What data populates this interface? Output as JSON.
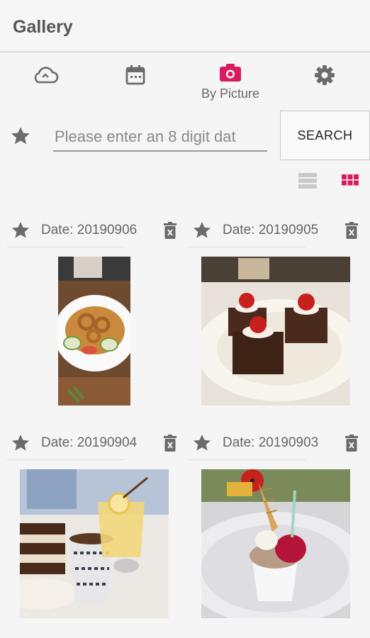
{
  "app": {
    "title": "Gallery"
  },
  "tabs": [
    {
      "icon": "cloud-icon",
      "label": ""
    },
    {
      "icon": "calendar-icon",
      "label": ""
    },
    {
      "icon": "camera-icon",
      "label": "By Picture",
      "active": true
    },
    {
      "icon": "gear-icon",
      "label": ""
    }
  ],
  "search": {
    "placeholder": "Please enter an 8 digit dat",
    "value": "",
    "button_label": "SEARCH"
  },
  "view": {
    "mode": "grid"
  },
  "colors": {
    "accent": "#d81b60",
    "icon": "#6b6b6b",
    "background": "#f5f5f5"
  },
  "items": [
    {
      "date_text": "Date: 20190906",
      "photo": "fried-calamari-salad"
    },
    {
      "date_text": "Date: 20190905",
      "photo": "chocolate-cakes-cherries"
    },
    {
      "date_text": "Date: 20190904",
      "photo": "layer-cake-coffee-lemonade"
    },
    {
      "date_text": "Date: 20190903",
      "photo": "ice-cream-cone-cup"
    }
  ]
}
